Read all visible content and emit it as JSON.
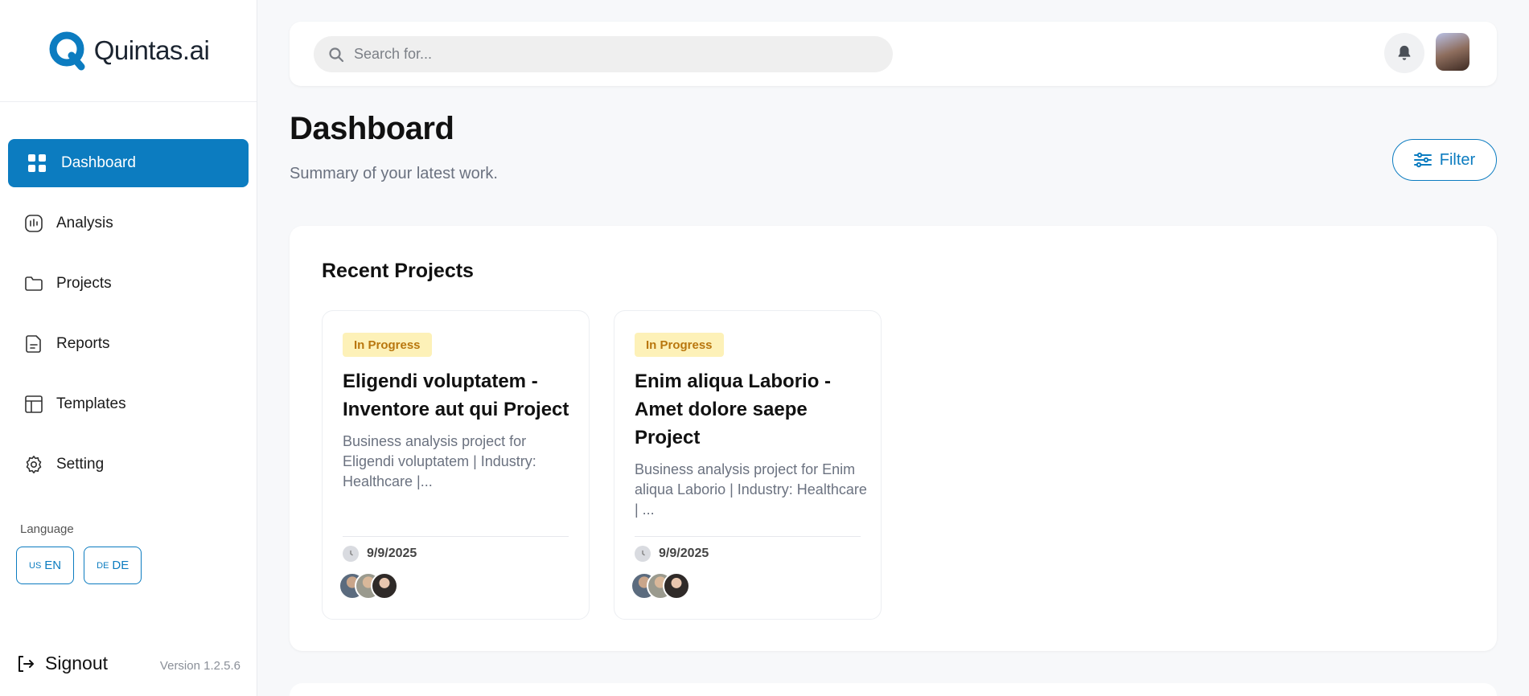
{
  "brand": {
    "name": "Quintas.ai",
    "accent": "#0c7cc0"
  },
  "sidebar": {
    "items": [
      {
        "label": "Dashboard",
        "icon": "grid-icon",
        "active": true
      },
      {
        "label": "Analysis",
        "icon": "chart-icon",
        "active": false
      },
      {
        "label": "Projects",
        "icon": "folder-icon",
        "active": false
      },
      {
        "label": "Reports",
        "icon": "report-icon",
        "active": false
      },
      {
        "label": "Templates",
        "icon": "template-icon",
        "active": false
      },
      {
        "label": "Setting",
        "icon": "gear-icon",
        "active": false
      }
    ],
    "language": {
      "title": "Language",
      "options": [
        {
          "flag": "US",
          "code": "EN"
        },
        {
          "flag": "DE",
          "code": "DE"
        }
      ]
    },
    "signout_label": "Signout",
    "version": "Version 1.2.5.6"
  },
  "topbar": {
    "search_placeholder": "Search for..."
  },
  "header": {
    "title": "Dashboard",
    "subtitle": "Summary of your latest work.",
    "filter_label": "Filter"
  },
  "recent": {
    "title": "Recent Projects",
    "projects": [
      {
        "status": "In Progress",
        "title": "Eligendi voluptatem - Inventore aut qui Project",
        "description": "Business analysis project for Eligendi voluptatem | Industry: Healthcare |...",
        "date": "9/9/2025"
      },
      {
        "status": "In Progress",
        "title": "Enim aliqua Laborio - Amet dolore saepe Project",
        "description": "Business analysis project for Enim aliqua Laborio | Industry: Healthcare | ...",
        "date": "9/9/2025"
      }
    ]
  }
}
